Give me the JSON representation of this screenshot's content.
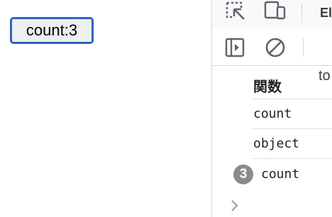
{
  "page": {
    "button_label": "count:3"
  },
  "devtools": {
    "toolbar": {
      "tab_partial": "El",
      "icons": [
        "inspect-element-icon",
        "device-toolbar-icon",
        "sidebar-toggle-icon",
        "clear-console-icon"
      ]
    },
    "filter_partial": "to",
    "table": {
      "header": "関数",
      "rows": [
        "count",
        "object"
      ]
    },
    "grouped_message": {
      "count": "3",
      "text": "count"
    },
    "prompt_icon": "chevron-right-icon",
    "colors": {
      "accent": "#2f63c2",
      "badge": "#8a8a8a",
      "border": "#d6d6d6"
    }
  }
}
